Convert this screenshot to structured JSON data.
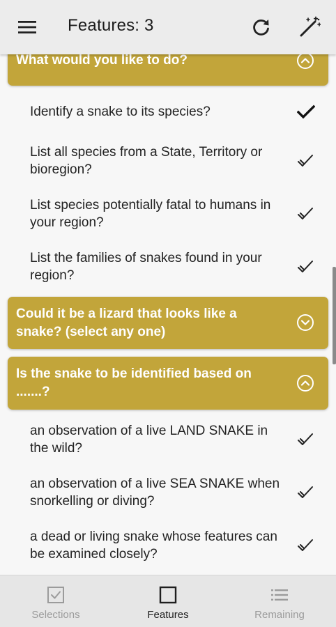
{
  "appbar": {
    "title": "Features: 3",
    "menu_icon": "menu-icon",
    "refresh_icon": "refresh-icon",
    "wand_icon": "magic-wand-icon"
  },
  "colors": {
    "header_bg": "#c2a53a",
    "appbar_bg": "#ececec",
    "bottomnav_bg": "#e6e6e6"
  },
  "sections": [
    {
      "title": "What would you like to do?",
      "expanded": true,
      "options": [
        {
          "text": "Identify a snake to its species?",
          "selected": true
        },
        {
          "text": "List all species from a State, Territory or bioregion?",
          "selected": false
        },
        {
          "text": "List species potentially fatal to humans in your region?",
          "selected": false
        },
        {
          "text": "List the families of snakes found in your region?",
          "selected": false
        }
      ]
    },
    {
      "title": "Could it be a lizard that looks like a snake? (select any one)",
      "expanded": false,
      "options": []
    },
    {
      "title": "Is the snake to be identified based on .......?",
      "expanded": true,
      "options": [
        {
          "text": "an observation of a live LAND SNAKE in the wild?",
          "selected": false
        },
        {
          "text": "an observation of a live SEA SNAKE when snorkelling or diving?",
          "selected": false
        },
        {
          "text": "a dead or living snake whose features can be examined closely?",
          "selected": false
        }
      ]
    }
  ],
  "bottom_nav": [
    {
      "label": "Selections",
      "icon": "checkbox-icon",
      "active": false
    },
    {
      "label": "Features",
      "icon": "square-icon",
      "active": true
    },
    {
      "label": "Remaining",
      "icon": "list-icon",
      "active": false
    }
  ]
}
